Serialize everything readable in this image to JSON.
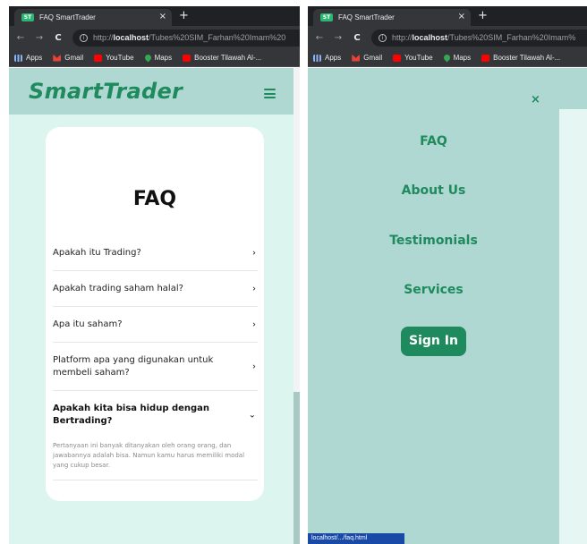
{
  "browser": {
    "tab_title": "FAQ SmartTrader",
    "tab_favicon": "ST",
    "tab_close": "×",
    "new_tab": "+",
    "back": "←",
    "forward": "→",
    "reload": "C",
    "url_prefix": "http://",
    "url_host": "localhost",
    "url_path_left": "/Tubes%20SIM_Farhan%20Imam%20",
    "url_path_right": "/Tubes%20SIM_Farhan%20Imam%",
    "bookmarks": [
      {
        "label": "Apps",
        "icon": "apps-icon"
      },
      {
        "label": "Gmail",
        "icon": "gmail-icon"
      },
      {
        "label": "YouTube",
        "icon": "youtube-icon"
      },
      {
        "label": "Maps",
        "icon": "maps-icon"
      },
      {
        "label": "Booster Tilawah Al-...",
        "icon": "booster-icon"
      }
    ],
    "status_url": "localhost/.../faq.html"
  },
  "site": {
    "logo": "SmartTrader",
    "brand_color": "#1e8a5e",
    "header_color": "#b0d8d2",
    "page_bg": "#dcf5ef"
  },
  "faq": {
    "title": "FAQ",
    "items": [
      {
        "question": "Apakah itu Trading?",
        "chevron": "›"
      },
      {
        "question": "Apakah trading saham halal?",
        "chevron": "›"
      },
      {
        "question": "Apa itu saham?",
        "chevron": "›"
      },
      {
        "question": "Platform apa yang digunakan untuk membeli saham?",
        "chevron": "›"
      },
      {
        "question": "Apakah kita bisa hidup dengan Bertrading?",
        "chevron": "⌄",
        "answer": "Pertanyaan ini banyak ditanyakan oleh orang orang, dan jawabannya adalah bisa. Namun kamu harus memiliki modal yang cukup besar."
      }
    ]
  },
  "menu": {
    "close": "×",
    "links": [
      "FAQ",
      "About Us",
      "Testimonials",
      "Services"
    ],
    "signin_label": "Sign In"
  }
}
